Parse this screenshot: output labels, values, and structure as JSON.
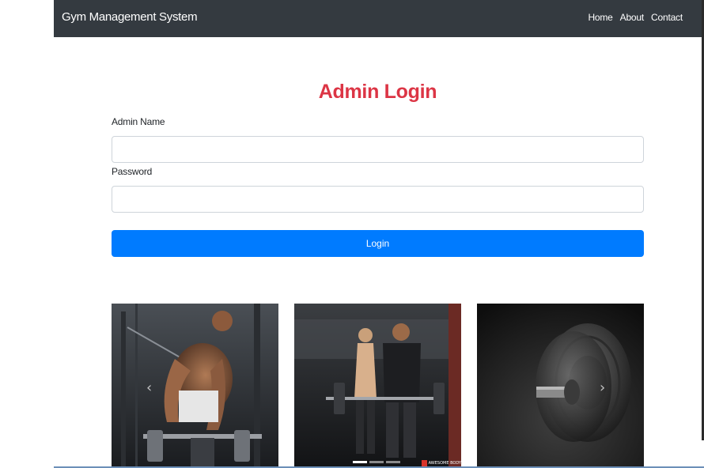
{
  "navbar": {
    "brand": "Gym Management System",
    "links": [
      {
        "label": "Home"
      },
      {
        "label": "About"
      },
      {
        "label": "Contact"
      }
    ]
  },
  "form": {
    "heading": "Admin Login",
    "admin_name_label": "Admin Name",
    "admin_name_value": "",
    "password_label": "Password",
    "password_value": "",
    "login_label": "Login"
  },
  "gallery": {
    "images": [
      {
        "name": "gym-deadlift-image"
      },
      {
        "name": "gym-couple-barbell-image"
      },
      {
        "name": "gym-dumbbell-plates-image"
      }
    ],
    "prev_arrow": "‹",
    "next_arrow": "›",
    "indicators": {
      "count": 3,
      "active_index": 0
    },
    "watermark_text": "AWESOME BODY"
  },
  "colors": {
    "navbar_bg": "#343a40",
    "heading": "#dc3545",
    "primary": "#007bff"
  }
}
